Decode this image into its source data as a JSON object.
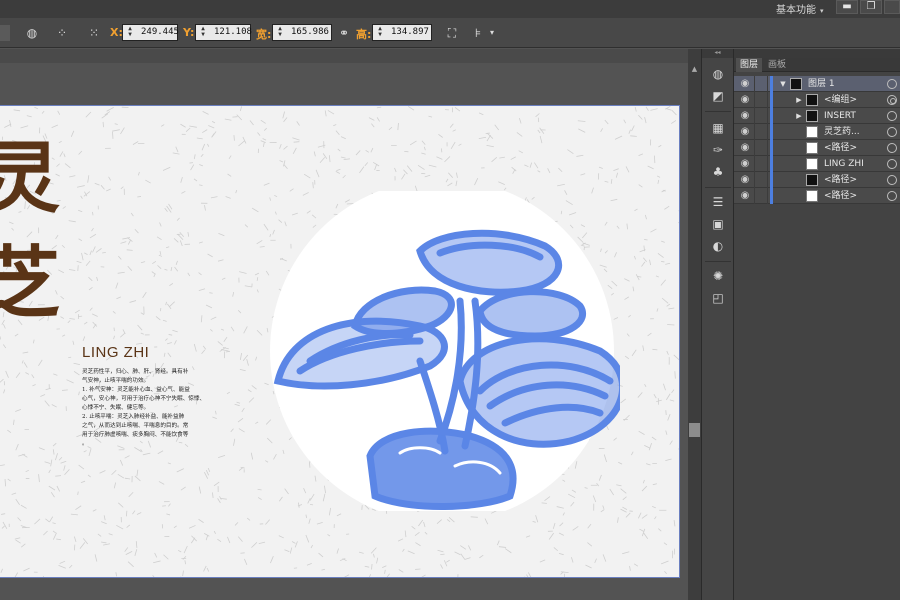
{
  "menubar": {
    "workspace_label": "基本功能",
    "workspace_caret": "▾",
    "minimize_glyph": "▬",
    "maximize_glyph": "❐"
  },
  "controlbar": {
    "x_label": "X:",
    "x_value": "249.445",
    "y_label": "Y:",
    "y_value": "121.108",
    "w_label": "宽:",
    "w_value": "165.986",
    "h_label": "高:",
    "h_value": "134.897",
    "unit_end": "‹"
  },
  "artwork": {
    "calligraphy": [
      "灵",
      "芝"
    ],
    "english_title": "LING ZHI",
    "body_lines": [
      "灵芝药性平，归心、肺、肝、肾经。具有补",
      "气安神，止咳平喘的功效。",
      "1. 补气安神：灵芝能补心血、益心气、能益",
      "心气，安心神，可用于治疗心神不宁失眠、惊悸、",
      "心悸不宁、失眠、健忘等。",
      "2. 止咳平喘：灵芝入肺经补益、能补益肺",
      "之气，从而达到止咳喘、平喘息的目的。常",
      "用于治疗肺虚咳喘、痰多胸闷、不能饮食等",
      "。"
    ],
    "accent_color": "#5a3416",
    "illustration_color": "#5b86e6",
    "illustration_name": "lingzhi-mushroom-illustration"
  },
  "panel": {
    "tabs": [
      "图层",
      "画板"
    ],
    "layers": [
      {
        "name": "图层 1",
        "twist": "▼",
        "thumb": "dark",
        "target": "single",
        "selected": true
      },
      {
        "name": "<编组>",
        "twist": "▶",
        "thumb": "dark",
        "target": "double",
        "selected": false
      },
      {
        "name": "INSERT",
        "twist": "▶",
        "thumb": "dark",
        "target": "single",
        "selected": false
      },
      {
        "name": "灵芝药...",
        "twist": "",
        "thumb": "light",
        "target": "single",
        "selected": false
      },
      {
        "name": "<路径>",
        "twist": "",
        "thumb": "light",
        "target": "single",
        "selected": false
      },
      {
        "name": "LING ZHI",
        "twist": "",
        "thumb": "light",
        "target": "single",
        "selected": false
      },
      {
        "name": "<路径>",
        "twist": "",
        "thumb": "dark",
        "target": "single",
        "selected": false
      },
      {
        "name": "<路径>",
        "twist": "",
        "thumb": "light",
        "target": "single",
        "selected": false
      }
    ],
    "eye_glyph": "◉"
  },
  "tools": {
    "head": "◂◂",
    "icons": [
      "◍",
      "◩",
      "▦",
      "✑",
      "♣",
      "☰",
      "▣",
      "◐",
      "✺",
      "◰"
    ]
  }
}
